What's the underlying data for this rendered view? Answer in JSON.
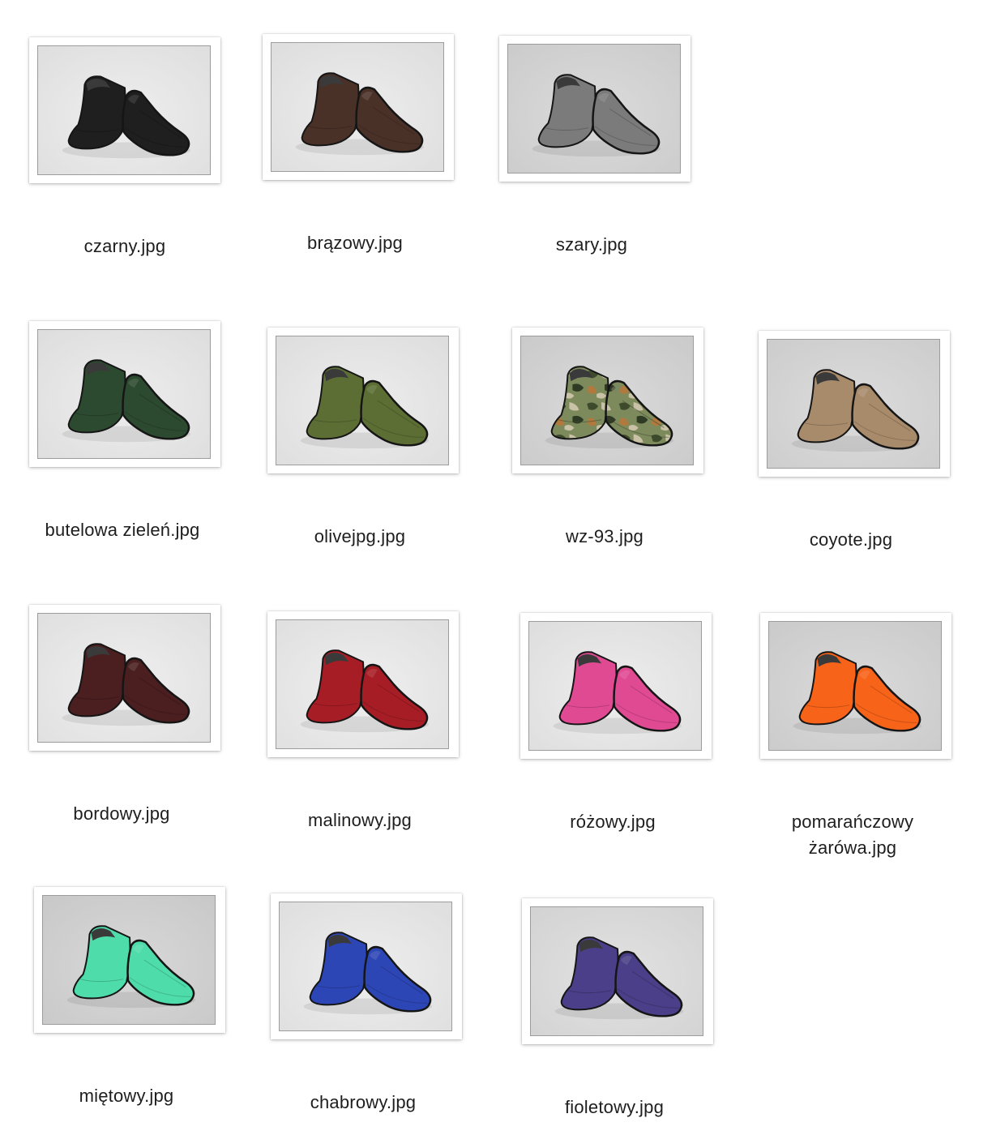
{
  "files": [
    {
      "name": "czarny.jpg",
      "color": "#1f1f1f",
      "pattern": "solid",
      "background": "#ededed"
    },
    {
      "name": "brązowy.jpg",
      "color": "#4a3128",
      "pattern": "solid",
      "background": "#ececec"
    },
    {
      "name": "szary.jpg",
      "color": "#7b7b7b",
      "pattern": "solid",
      "background": "#d9d9d9"
    },
    {
      "name": "butelowa zieleń.jpg",
      "color": "#2c4a2f",
      "pattern": "solid",
      "background": "#ececec"
    },
    {
      "name": "olivejpg.jpg",
      "color": "#5c6e34",
      "pattern": "solid",
      "background": "#ececec"
    },
    {
      "name": "wz-93.jpg",
      "color": "#5e6d45",
      "pattern": "camo",
      "background": "#d8d8d8"
    },
    {
      "name": "coyote.jpg",
      "color": "#a88b6b",
      "pattern": "solid",
      "background": "#dadada"
    },
    {
      "name": "bordowy.jpg",
      "color": "#4b1e20",
      "pattern": "solid",
      "background": "#eeeeee"
    },
    {
      "name": "malinowy.jpg",
      "color": "#a71d26",
      "pattern": "solid",
      "background": "#eeeeee"
    },
    {
      "name": "różowy.jpg",
      "color": "#e04a93",
      "pattern": "solid",
      "background": "#ececec"
    },
    {
      "name": "pomarańczowy żarówa.jpg",
      "color": "#f76318",
      "pattern": "solid",
      "background": "#d8d8d8"
    },
    {
      "name": "miętowy.jpg",
      "color": "#4fdcab",
      "pattern": "solid",
      "background": "#d6d6d6"
    },
    {
      "name": "chabrowy.jpg",
      "color": "#2d46b5",
      "pattern": "solid",
      "background": "#ededed"
    },
    {
      "name": "fioletowy.jpg",
      "color": "#4a3f88",
      "pattern": "solid",
      "background": "#e0e0e0"
    }
  ]
}
